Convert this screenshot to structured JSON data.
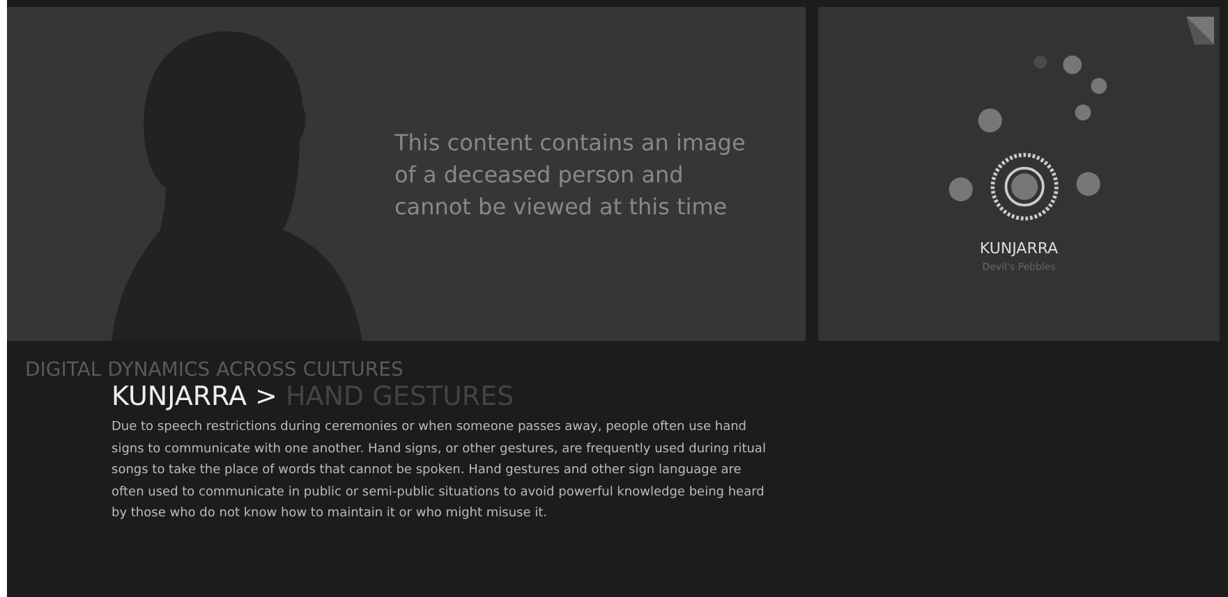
{
  "notice": {
    "text": "This content contains an image of a deceased person and cannot be viewed at this time"
  },
  "story": {
    "title": "KUNJARRA",
    "subtitle": "Devil's Pebbles"
  },
  "section": {
    "heading": "DIGITAL DYNAMICS ACROSS CULTURES",
    "crumb": "KUNJARRA >",
    "topic": "HAND GESTURES",
    "body": "Due to speech restrictions during ceremonies or when someone passes away, people often use hand signs to communicate with one another. Hand signs, or other gestures, are frequently used during ritual songs to take the place of words that cannot be spoken. Hand gestures and other sign language are often used to communicate in public or semi-public situations to avoid powerful knowledge being heard by those who do not know how to maintain it or who might misuse it."
  }
}
